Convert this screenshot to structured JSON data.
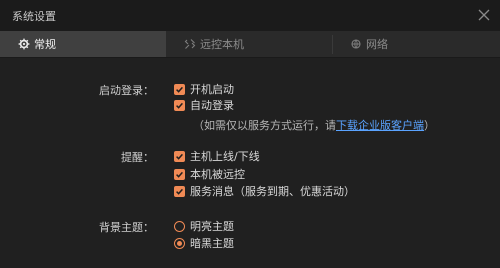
{
  "window": {
    "title": "系统设置"
  },
  "tabs": [
    {
      "label": "常规",
      "icon": "gear-icon",
      "active": true
    },
    {
      "label": "远控本机",
      "icon": "remote-control-icon",
      "active": false
    },
    {
      "label": "网络",
      "icon": "network-icon",
      "active": false
    }
  ],
  "startup": {
    "label": "启动登录：",
    "options": [
      {
        "label": "开机启动",
        "checked": true
      },
      {
        "label": "自动登录",
        "checked": true
      }
    ],
    "hint_prefix": "（如需仅以服务方式运行，请",
    "hint_link": "下载企业版客户端",
    "hint_suffix": "）"
  },
  "reminder": {
    "label": "提醒：",
    "options": [
      {
        "label": "主机上线/下线",
        "checked": true
      },
      {
        "label": "本机被远控",
        "checked": true
      },
      {
        "label": "服务消息（服务到期、优惠活动）",
        "checked": true
      }
    ]
  },
  "theme": {
    "label": "背景主题：",
    "options": [
      {
        "label": "明亮主题",
        "selected": false
      },
      {
        "label": "暗黑主题",
        "selected": true
      }
    ]
  },
  "colors": {
    "accent": "#f08a55",
    "link": "#5aa3ff",
    "background": "#202020"
  }
}
